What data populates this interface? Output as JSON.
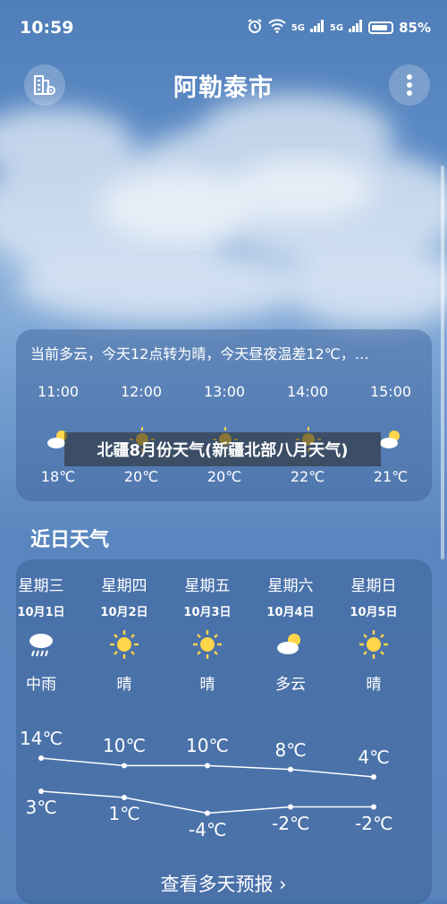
{
  "status_bar": {
    "time": "10:59",
    "battery": "85%",
    "net1": "5G",
    "net2": "5G"
  },
  "header": {
    "city": "阿勒泰市"
  },
  "hourly": {
    "summary": "当前多云，今天12点转为晴，今天昼夜温差12℃，…",
    "hours": [
      {
        "time": "11:00",
        "icon": "partly-sunny-icon",
        "temp": "18℃"
      },
      {
        "time": "12:00",
        "icon": "sun-icon",
        "temp": "20℃"
      },
      {
        "time": "13:00",
        "icon": "sun-icon",
        "temp": "20℃"
      },
      {
        "time": "14:00",
        "icon": "sun-icon",
        "temp": "22℃"
      },
      {
        "time": "15:00",
        "icon": "partly-sunny-icon",
        "temp": "21℃"
      }
    ]
  },
  "banner": {
    "text": "北疆8月份天气(新疆北部八月天气)"
  },
  "daily": {
    "title": "近日天气",
    "days": [
      {
        "name": "星期三",
        "date": "10月1日",
        "icon": "rain-icon",
        "cond": "中雨",
        "high": "14℃",
        "low": "3℃",
        "high_val": 14,
        "low_val": 3
      },
      {
        "name": "星期四",
        "date": "10月2日",
        "icon": "sun-icon",
        "cond": "晴",
        "high": "10℃",
        "low": "1℃",
        "high_val": 10,
        "low_val": 1
      },
      {
        "name": "星期五",
        "date": "10月3日",
        "icon": "sun-icon",
        "cond": "晴",
        "high": "10℃",
        "low": "-4℃",
        "high_val": 10,
        "low_val": -4
      },
      {
        "name": "星期六",
        "date": "10月4日",
        "icon": "partly-cloudy-icon",
        "cond": "多云",
        "high": "8℃",
        "low": "-2℃",
        "high_val": 8,
        "low_val": -2
      },
      {
        "name": "星期日",
        "date": "10月5日",
        "icon": "sun-icon",
        "cond": "晴",
        "high": "4℃",
        "low": "-2℃",
        "high_val": 4,
        "low_val": -2
      }
    ],
    "more_label": "查看多天预报 ›"
  },
  "colors": {
    "sun": "#ffd54a",
    "cloud": "#ffffff",
    "card": "rgba(55,90,145,0.45)"
  }
}
